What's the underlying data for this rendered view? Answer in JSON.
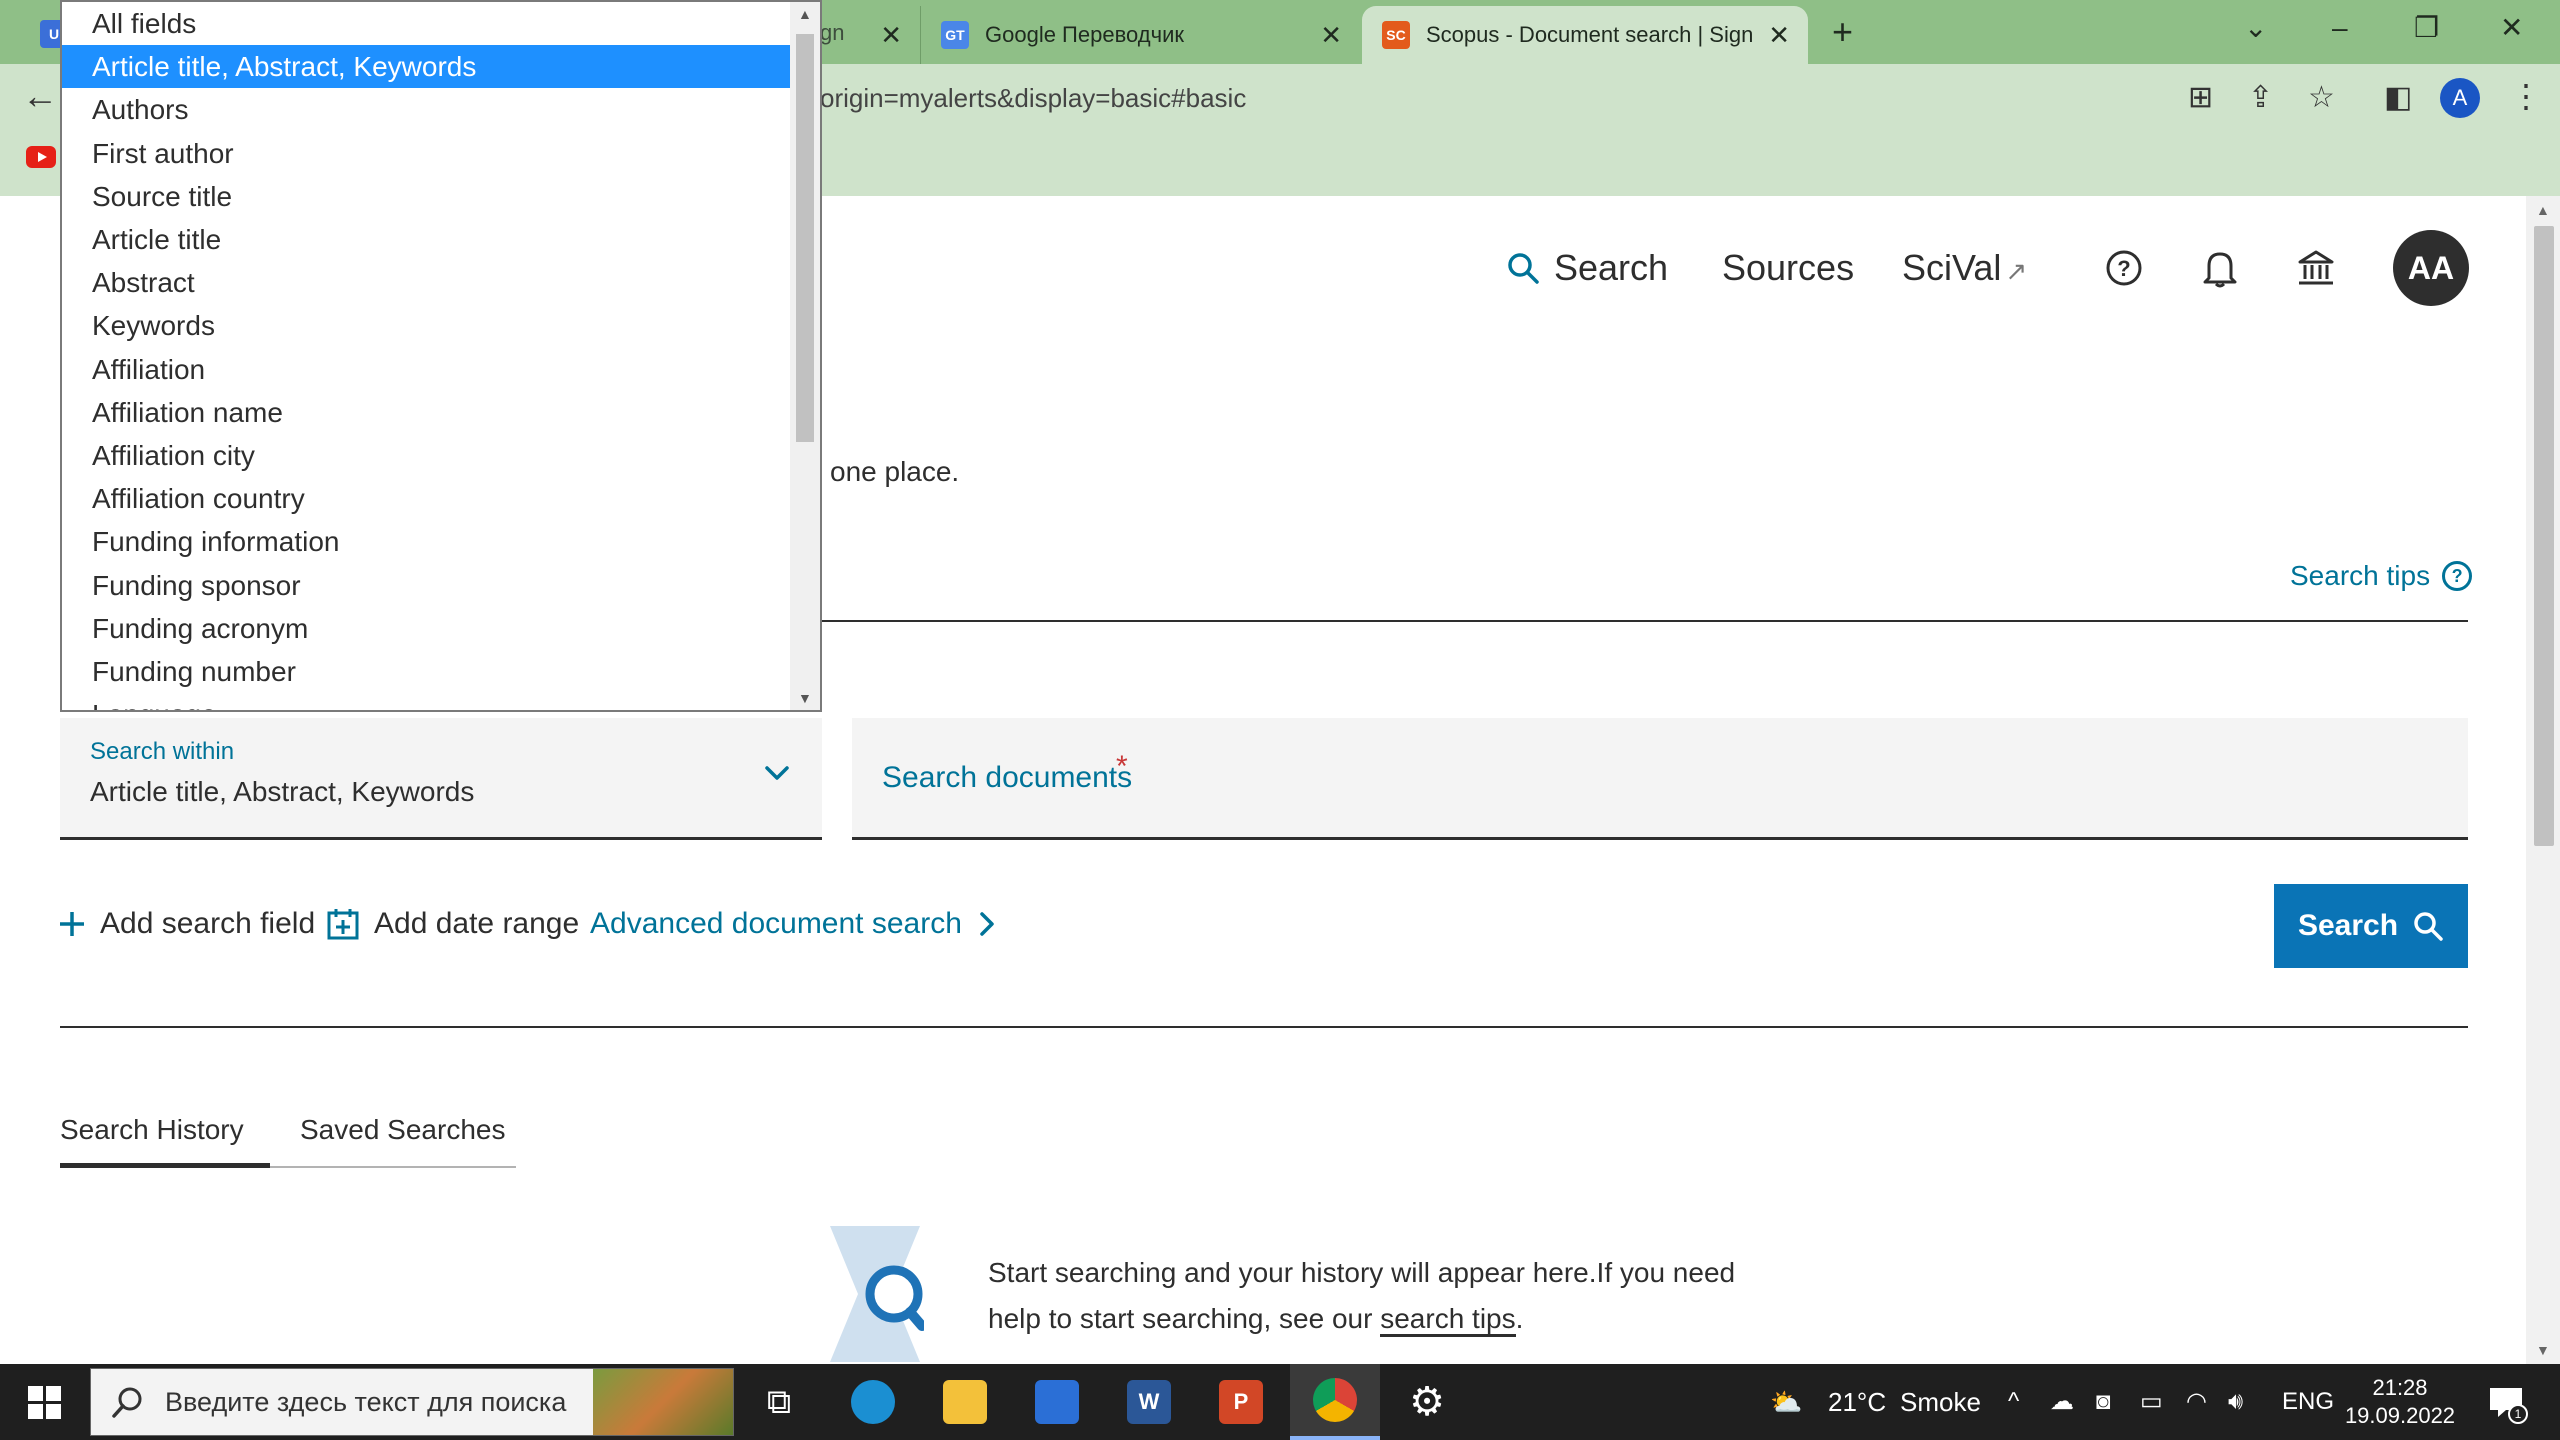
{
  "browser": {
    "tabs": [
      {
        "title": "gn",
        "favicon": "U"
      },
      {
        "title": "Google Переводчик",
        "favicon": "GT"
      },
      {
        "title": "Scopus - Document search | Sign",
        "favicon": "SC"
      }
    ],
    "url": "origin=myalerts&display=basic#basic",
    "profile_initial": "A",
    "close_glyph": "✕",
    "new_tab_glyph": "+"
  },
  "nav": {
    "search": "Search",
    "sources": "Sources",
    "scival": "SciVal",
    "avatar_initials": "AA"
  },
  "intro_text": "one place.",
  "search_tips": "Search tips",
  "search_within": {
    "label": "Search within",
    "value": "Article title, Abstract, Keywords"
  },
  "search_documents": {
    "placeholder": "Search documents",
    "required_mark": "*"
  },
  "actions": {
    "add_search_field": "Add search field",
    "add_date_range": "Add date range",
    "advanced_search": "Advanced document search",
    "search_button": "Search"
  },
  "dropdown": {
    "selected_index": 1,
    "options": [
      "All fields",
      "Article title, Abstract, Keywords",
      "Authors",
      "First author",
      "Source title",
      "Article title",
      "Abstract",
      "Keywords",
      "Affiliation",
      "Affiliation name",
      "Affiliation city",
      "Affiliation country",
      "Funding information",
      "Funding sponsor",
      "Funding acronym",
      "Funding number",
      "Language"
    ]
  },
  "history_tabs": {
    "history": "Search History",
    "saved": "Saved Searches"
  },
  "empty_state": {
    "text": "Start searching and your history will appear here.If you need help to start searching, see our",
    "link": "search tips",
    "end": "."
  },
  "taskbar": {
    "search_placeholder": "Введите здесь текст для поиска",
    "weather": "21°C",
    "weather_desc": "Smoke",
    "language": "ENG",
    "time": "21:28",
    "date": "19.09.2022",
    "notification_count": "1"
  },
  "colors": {
    "accent": "#007398",
    "button": "#0a74b6",
    "selected_option": "#1e90ff",
    "tabbar": "#8fbf87",
    "toolbar": "#cfe3cb"
  }
}
